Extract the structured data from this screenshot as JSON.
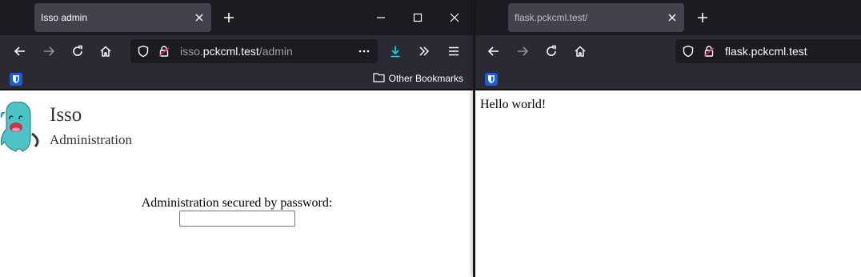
{
  "left_window": {
    "tab": {
      "title": "Isso admin"
    },
    "url": {
      "domain_prefix": "isso.",
      "domain_main": "pckcml.test",
      "path": "/admin"
    },
    "bookmarks": {
      "other_label": "Other Bookmarks"
    },
    "page": {
      "title": "Isso",
      "subtitle": "Administration",
      "auth_label": "Administration secured by password:",
      "password_value": ""
    }
  },
  "right_window": {
    "tab": {
      "title": "flask.pckcml.test/"
    },
    "url": {
      "text": "flask.pckcml.test"
    },
    "page": {
      "content": "Hello world!"
    }
  },
  "icons": [
    "close-icon",
    "plus-icon",
    "minimize-icon",
    "maximize-icon",
    "back-arrow-icon",
    "forward-arrow-icon",
    "reload-icon",
    "home-icon",
    "shield-icon",
    "lock-icon",
    "more-icon",
    "download-icon",
    "chevrons-icon",
    "menu-icon",
    "bitwarden-icon",
    "folder-icon"
  ],
  "colors": {
    "chrome_dark": "#1c1b22",
    "toolbar": "#2b2a33",
    "tab_active": "#42414d",
    "download_accent": "#00ddff",
    "mascot": "#4cc3c7"
  }
}
